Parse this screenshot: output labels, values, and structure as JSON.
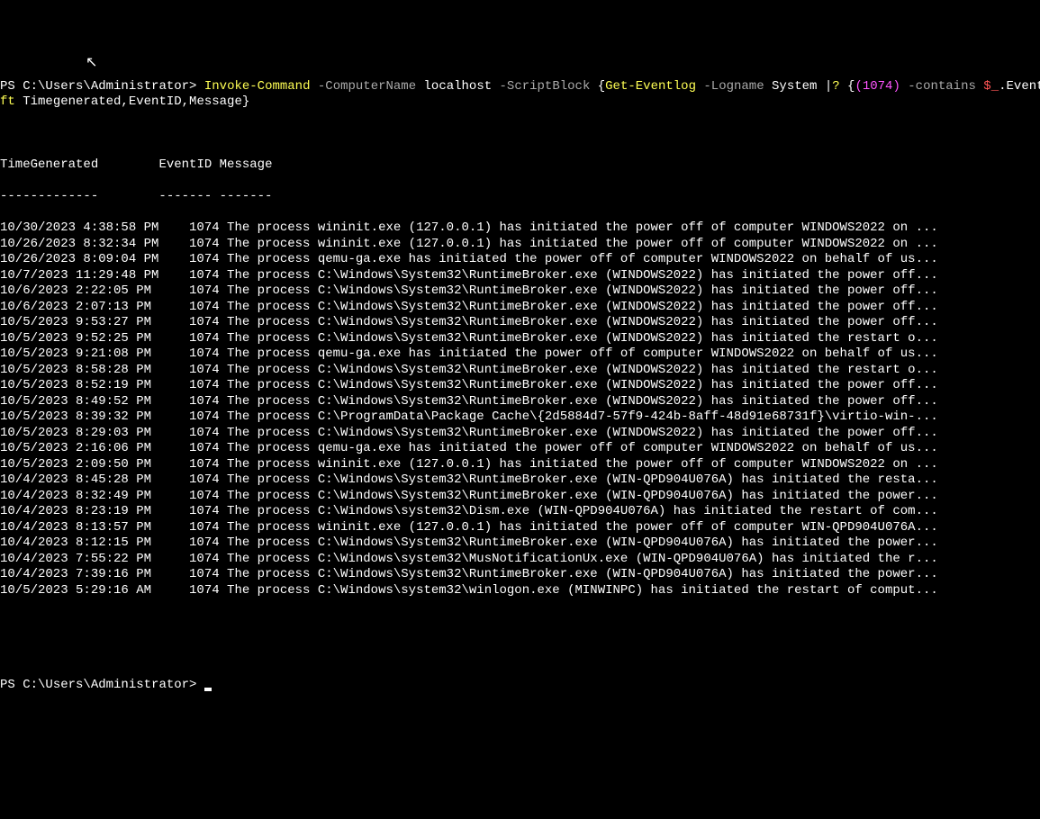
{
  "prompt1_ps": "PS ",
  "prompt1_path": "C:\\Users\\Administrator> ",
  "cmd_invoke": "Invoke-Command",
  "cmd_computername_flag": " -ComputerName",
  "cmd_localhost": " localhost",
  "cmd_scriptblock_flag": " -ScriptBlock",
  "cmd_block_open": " {",
  "cmd_geteventlog": "Get-Eventlog",
  "cmd_logname_flag": " -Logname",
  "cmd_system": " System ",
  "cmd_pipe1": "|",
  "cmd_where": "? ",
  "cmd_inner_open": "{",
  "cmd_paren": "(1074)",
  "cmd_contains": " -contains ",
  "cmd_dollar": "$_",
  "cmd_dot": ".EventID",
  "cmd_close1": "}",
  "cmd_close2": " ",
  "cmd_pipe2": "|",
  "cmd_ft": "ft",
  "cmd_ft_args": " Timegenerated,EventID,Message",
  "cmd_close3": "}",
  "header_time": "TimeGenerated",
  "header_eventid": "EventID",
  "header_message": "Message",
  "header_underline": "-------------        ------- -------",
  "rows": [
    {
      "time": "10/30/2023 4:38:58 PM",
      "id": "1074",
      "msg": "The process wininit.exe (127.0.0.1) has initiated the power off of computer WINDOWS2022 on ..."
    },
    {
      "time": "10/26/2023 8:32:34 PM",
      "id": "1074",
      "msg": "The process wininit.exe (127.0.0.1) has initiated the power off of computer WINDOWS2022 on ..."
    },
    {
      "time": "10/26/2023 8:09:04 PM",
      "id": "1074",
      "msg": "The process qemu-ga.exe has initiated the power off of computer WINDOWS2022 on behalf of us..."
    },
    {
      "time": "10/7/2023 11:29:48 PM",
      "id": "1074",
      "msg": "The process C:\\Windows\\System32\\RuntimeBroker.exe (WINDOWS2022) has initiated the power off..."
    },
    {
      "time": "10/6/2023 2:22:05 PM ",
      "id": "1074",
      "msg": "The process C:\\Windows\\System32\\RuntimeBroker.exe (WINDOWS2022) has initiated the power off..."
    },
    {
      "time": "10/6/2023 2:07:13 PM ",
      "id": "1074",
      "msg": "The process C:\\Windows\\System32\\RuntimeBroker.exe (WINDOWS2022) has initiated the power off..."
    },
    {
      "time": "10/5/2023 9:53:27 PM ",
      "id": "1074",
      "msg": "The process C:\\Windows\\System32\\RuntimeBroker.exe (WINDOWS2022) has initiated the power off..."
    },
    {
      "time": "10/5/2023 9:52:25 PM ",
      "id": "1074",
      "msg": "The process C:\\Windows\\System32\\RuntimeBroker.exe (WINDOWS2022) has initiated the restart o..."
    },
    {
      "time": "10/5/2023 9:21:08 PM ",
      "id": "1074",
      "msg": "The process qemu-ga.exe has initiated the power off of computer WINDOWS2022 on behalf of us..."
    },
    {
      "time": "10/5/2023 8:58:28 PM ",
      "id": "1074",
      "msg": "The process C:\\Windows\\System32\\RuntimeBroker.exe (WINDOWS2022) has initiated the restart o..."
    },
    {
      "time": "10/5/2023 8:52:19 PM ",
      "id": "1074",
      "msg": "The process C:\\Windows\\System32\\RuntimeBroker.exe (WINDOWS2022) has initiated the power off..."
    },
    {
      "time": "10/5/2023 8:49:52 PM ",
      "id": "1074",
      "msg": "The process C:\\Windows\\System32\\RuntimeBroker.exe (WINDOWS2022) has initiated the power off..."
    },
    {
      "time": "10/5/2023 8:39:32 PM ",
      "id": "1074",
      "msg": "The process C:\\ProgramData\\Package Cache\\{2d5884d7-57f9-424b-8aff-48d91e68731f}\\virtio-win-..."
    },
    {
      "time": "10/5/2023 8:29:03 PM ",
      "id": "1074",
      "msg": "The process C:\\Windows\\System32\\RuntimeBroker.exe (WINDOWS2022) has initiated the power off..."
    },
    {
      "time": "10/5/2023 2:16:06 PM ",
      "id": "1074",
      "msg": "The process qemu-ga.exe has initiated the power off of computer WINDOWS2022 on behalf of us..."
    },
    {
      "time": "10/5/2023 2:09:50 PM ",
      "id": "1074",
      "msg": "The process wininit.exe (127.0.0.1) has initiated the power off of computer WINDOWS2022 on ..."
    },
    {
      "time": "10/4/2023 8:45:28 PM ",
      "id": "1074",
      "msg": "The process C:\\Windows\\System32\\RuntimeBroker.exe (WIN-QPD904U076A) has initiated the resta..."
    },
    {
      "time": "10/4/2023 8:32:49 PM ",
      "id": "1074",
      "msg": "The process C:\\Windows\\System32\\RuntimeBroker.exe (WIN-QPD904U076A) has initiated the power..."
    },
    {
      "time": "10/4/2023 8:23:19 PM ",
      "id": "1074",
      "msg": "The process C:\\Windows\\system32\\Dism.exe (WIN-QPD904U076A) has initiated the restart of com..."
    },
    {
      "time": "10/4/2023 8:13:57 PM ",
      "id": "1074",
      "msg": "The process wininit.exe (127.0.0.1) has initiated the power off of computer WIN-QPD904U076A..."
    },
    {
      "time": "10/4/2023 8:12:15 PM ",
      "id": "1074",
      "msg": "The process C:\\Windows\\System32\\RuntimeBroker.exe (WIN-QPD904U076A) has initiated the power..."
    },
    {
      "time": "10/4/2023 7:55:22 PM ",
      "id": "1074",
      "msg": "The process C:\\Windows\\system32\\MusNotificationUx.exe (WIN-QPD904U076A) has initiated the r..."
    },
    {
      "time": "10/4/2023 7:39:16 PM ",
      "id": "1074",
      "msg": "The process C:\\Windows\\System32\\RuntimeBroker.exe (WIN-QPD904U076A) has initiated the power..."
    },
    {
      "time": "10/5/2023 5:29:16 AM ",
      "id": "1074",
      "msg": "The process C:\\Windows\\system32\\winlogon.exe (MINWINPC) has initiated the restart of comput..."
    }
  ],
  "prompt2_ps": "PS ",
  "prompt2_path": "C:\\Users\\Administrator> "
}
